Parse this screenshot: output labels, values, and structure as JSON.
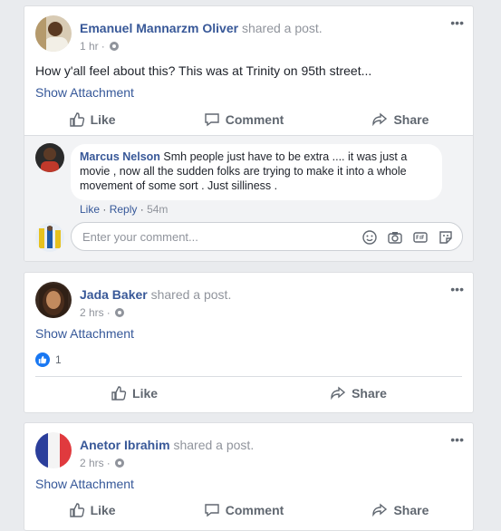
{
  "posts": [
    {
      "author": "Emanuel Mannarzm Oliver",
      "shared_prefix": "shared a",
      "shared_link": "post",
      "time": "1 hr",
      "text": "How y'all feel about this? This was at Trinity on 95th street...",
      "attachment_label": "Show Attachment",
      "actions": {
        "like": "Like",
        "comment": "Comment",
        "share": "Share"
      },
      "comment": {
        "author": "Marcus Nelson",
        "text": "Smh people just have to be extra .... it was just a movie , now all the sudden folks are trying to make it into a whole movement of some sort . Just silliness .",
        "like": "Like",
        "reply": "Reply",
        "time": "54m"
      },
      "comment_input_placeholder": "Enter your comment..."
    },
    {
      "author": "Jada Baker",
      "shared_prefix": "shared a",
      "shared_link": "post",
      "time": "2 hrs",
      "attachment_label": "Show Attachment",
      "like_count": "1",
      "actions": {
        "like": "Like",
        "share": "Share"
      }
    },
    {
      "author": "Anetor Ibrahim",
      "shared_prefix": "shared a",
      "shared_link": "post",
      "time": "2 hrs",
      "attachment_label": "Show Attachment",
      "actions": {
        "like": "Like",
        "comment": "Comment",
        "share": "Share"
      }
    }
  ],
  "colors": {
    "link": "#385898",
    "meta": "#90949c",
    "background": "#e9ebee",
    "like_blue": "#1877f2"
  }
}
